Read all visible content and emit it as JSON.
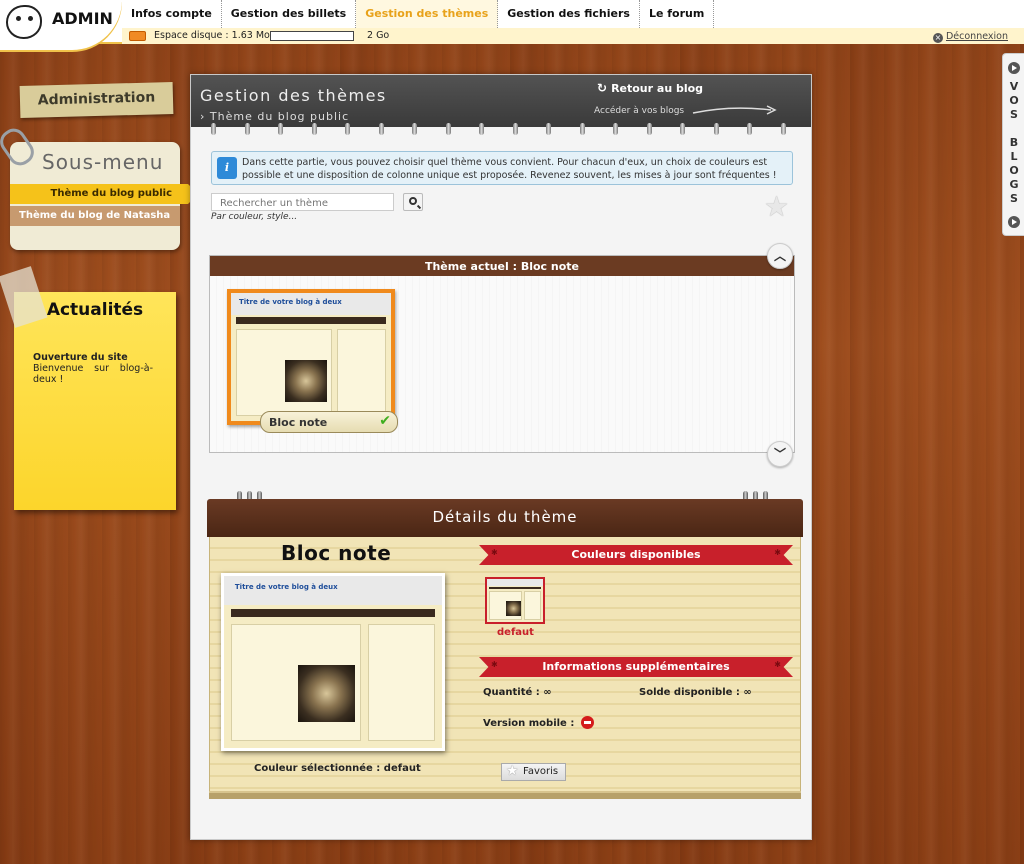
{
  "app": {
    "logo_text": "ADMIN"
  },
  "nav": {
    "tabs": [
      {
        "label": "Infos compte",
        "active": false
      },
      {
        "label": "Gestion des billets",
        "active": false
      },
      {
        "label": "Gestion des thèmes",
        "active": true
      },
      {
        "label": "Gestion des fichiers",
        "active": false
      },
      {
        "label": "Le forum",
        "active": false
      }
    ]
  },
  "disk": {
    "label": "Espace disque : 1.63 Mo",
    "max": "2 Go",
    "usage_fraction": 0.0008
  },
  "logout": {
    "label": "Déconnexion"
  },
  "side_tab": {
    "label": "VOS BLOGS"
  },
  "sidebar": {
    "admin_label": "Administration",
    "submenu_title": "Sous-menu",
    "items": [
      {
        "label": "Thème du blog public",
        "current": true
      },
      {
        "label": "Thème du blog de Natasha",
        "current": false
      }
    ],
    "news": {
      "title": "Actualités",
      "headline": "Ouverture du site",
      "body": "Bienvenue sur blog-à-deux !"
    }
  },
  "main": {
    "title": "Gestion des thèmes",
    "breadcrumb": "› Thème du blog public",
    "back_to_blog": "Retour au blog",
    "access_blogs": "Accéder à vos blogs",
    "info_text": "Dans cette partie, vous pouvez choisir quel thème vous convient. Pour chacun d'eux, un choix de couleurs est possible et une disposition de colonne unique est proposée. Revenez souvent, les mises à jour sont fréquentes !",
    "search": {
      "placeholder": "Rechercher un thème",
      "hint": "Par couleur, style..."
    },
    "current_theme": {
      "header": "Thème actuel : Bloc note",
      "card_label": "Bloc note",
      "preview_title": "Titre de votre blog à deux"
    },
    "details": {
      "header": "Détails du thème",
      "theme_name": "Bloc note",
      "preview_title": "Titre de votre blog à deux",
      "colors_ribbon": "Couleurs disponibles",
      "swatch_label": "defaut",
      "info_ribbon": "Informations supplémentaires",
      "quantity": "Quantité : ∞",
      "balance": "Solde disponible : ∞",
      "mobile_version": "Version mobile :",
      "mobile_available": false,
      "selected_color": "Couleur sélectionnée : defaut",
      "favorite_button": "Favoris"
    }
  },
  "colors": {
    "accent_yellow": "#f0c24a",
    "active_tab_text": "#e8a21a",
    "ribbon_red": "#c8202b",
    "header_brown": "#6b3b22"
  },
  "icons": {
    "logo": "stick-face-icon",
    "disk": "disk-icon",
    "logout": "close-circle-icon",
    "info": "info-icon",
    "search": "search-icon",
    "star": "star-icon",
    "check": "check-icon",
    "up": "chevron-up-icon",
    "down": "chevron-down-icon",
    "mobile": "minus-circle-icon"
  }
}
